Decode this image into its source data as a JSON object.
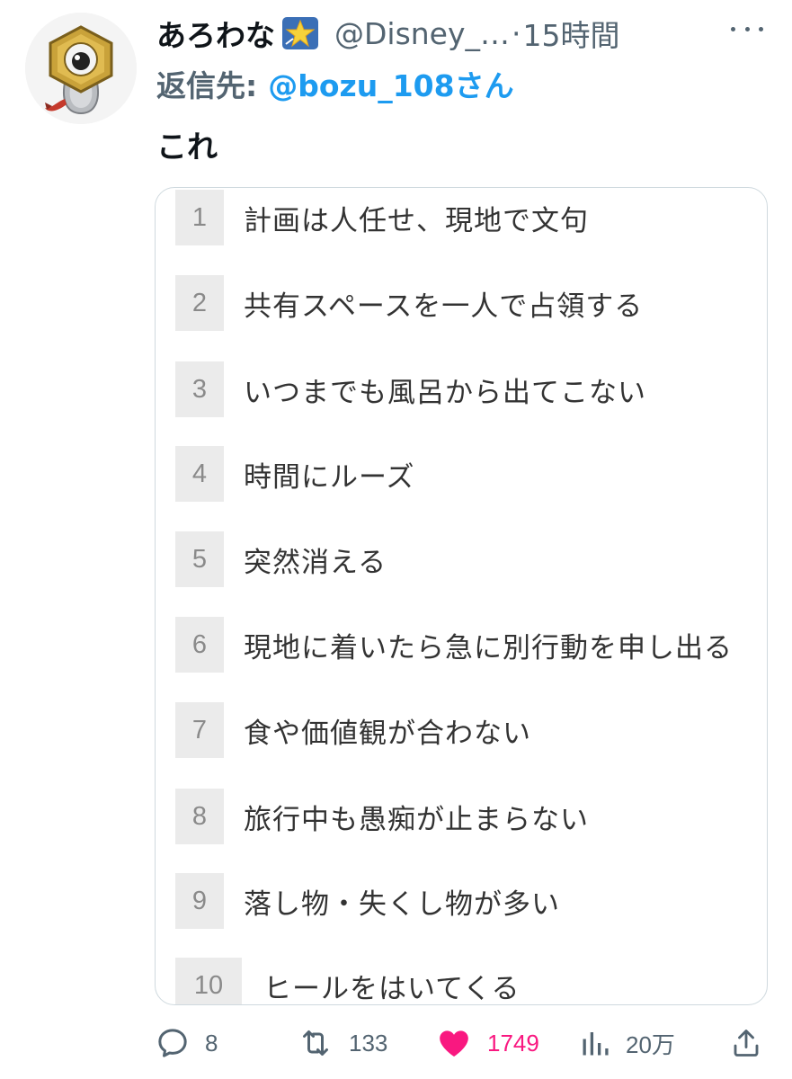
{
  "tweet": {
    "author": {
      "display_name": "あろわな",
      "handle": "@Disney_…",
      "separator": "·",
      "time": "15時間"
    },
    "reply_to": {
      "prefix": "返信先:",
      "handle": "@bozu_108さん"
    },
    "text": "これ",
    "list": [
      {
        "num": "1",
        "text": "計画は人任せ、現地で文句"
      },
      {
        "num": "2",
        "text": "共有スペースを一人で占領する"
      },
      {
        "num": "3",
        "text": "いつまでも風呂から出てこない"
      },
      {
        "num": "4",
        "text": "時間にルーズ"
      },
      {
        "num": "5",
        "text": "突然消える"
      },
      {
        "num": "6",
        "text": "現地に着いたら急に別行動を申し出る"
      },
      {
        "num": "7",
        "text": "食や価値観が合わない"
      },
      {
        "num": "8",
        "text": "旅行中も愚痴が止まらない"
      },
      {
        "num": "9",
        "text": "落し物・失くし物が多い"
      },
      {
        "num": "10",
        "text": "ヒールをはいてくる"
      }
    ],
    "actions": {
      "replies": "8",
      "retweets": "133",
      "likes": "1749",
      "views": "20万"
    },
    "colors": {
      "accent": "#1d9bf0",
      "like": "#f91880",
      "muted": "#536471"
    }
  }
}
